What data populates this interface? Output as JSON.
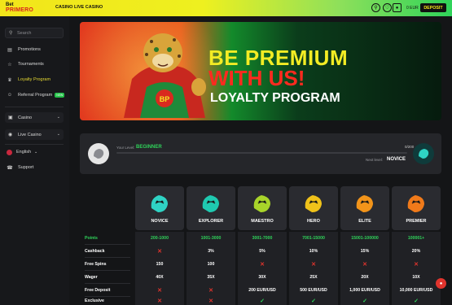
{
  "topbar": {
    "logo_top": "Bet",
    "logo_bottom": "PRIMERO",
    "nav": [
      "CASINO",
      "LIVE CASINO"
    ],
    "balance": "0 EUR",
    "deposit_label": "DEPOSIT"
  },
  "sidebar": {
    "search_placeholder": "Search",
    "items": [
      {
        "label": "Promotions"
      },
      {
        "label": "Tournaments"
      },
      {
        "label": "Loyalty Program"
      },
      {
        "label": "Referral Program",
        "badge": "NEW"
      }
    ],
    "casino": "Casino",
    "live_casino": "Live Casino",
    "language": "English",
    "support": "Support"
  },
  "banner": {
    "line1": "BE PREMIUM",
    "line2": "WITH US!",
    "line3": "LOYALTY PROGRAM",
    "emblem": "BP"
  },
  "level": {
    "label": "Your Level:",
    "value": "BEGINNER",
    "progress_text": "0/200",
    "progress_fraction": 0.0,
    "next_label": "Next level:",
    "next_value": "NOVICE"
  },
  "tiers": [
    {
      "name": "NOVICE",
      "color": "#2fd3c4"
    },
    {
      "name": "EXPLORER",
      "color": "#1fc9b0"
    },
    {
      "name": "MAESTRO",
      "color": "#a8d42a"
    },
    {
      "name": "HERO",
      "color": "#f0c21a"
    },
    {
      "name": "ELITE",
      "color": "#f2941a"
    },
    {
      "name": "PREMIER",
      "color": "#f07a1a"
    }
  ],
  "rows": [
    {
      "label": "Points",
      "green": true,
      "values": [
        "200-1000",
        "1001-3000",
        "3001-7000",
        "7001-15000",
        "15001-100000",
        "100001+"
      ]
    },
    {
      "label": "Cashback",
      "values": [
        "no",
        "3%",
        "5%",
        "10%",
        "15%",
        "20%"
      ]
    },
    {
      "label": "Free Spins",
      "values": [
        "150",
        "100",
        "no",
        "no",
        "no",
        "no"
      ]
    },
    {
      "label": "Wager",
      "values": [
        "40X",
        "35X",
        "30X",
        "25X",
        "20X",
        "10X"
      ]
    },
    {
      "label": "Free Deposit",
      "values": [
        "no",
        "no",
        "200 EUR/USD",
        "500 EUR/USD",
        "1,000 EUR/USD",
        "10,000 EUR/USD"
      ]
    },
    {
      "label": "Exclusive",
      "values": [
        "no",
        "no",
        "yes",
        "yes",
        "yes",
        "yes"
      ]
    }
  ],
  "colors": {
    "accent_yellow": "#f2e51a",
    "accent_green": "#2fd35a",
    "no_red": "#e0342d"
  }
}
